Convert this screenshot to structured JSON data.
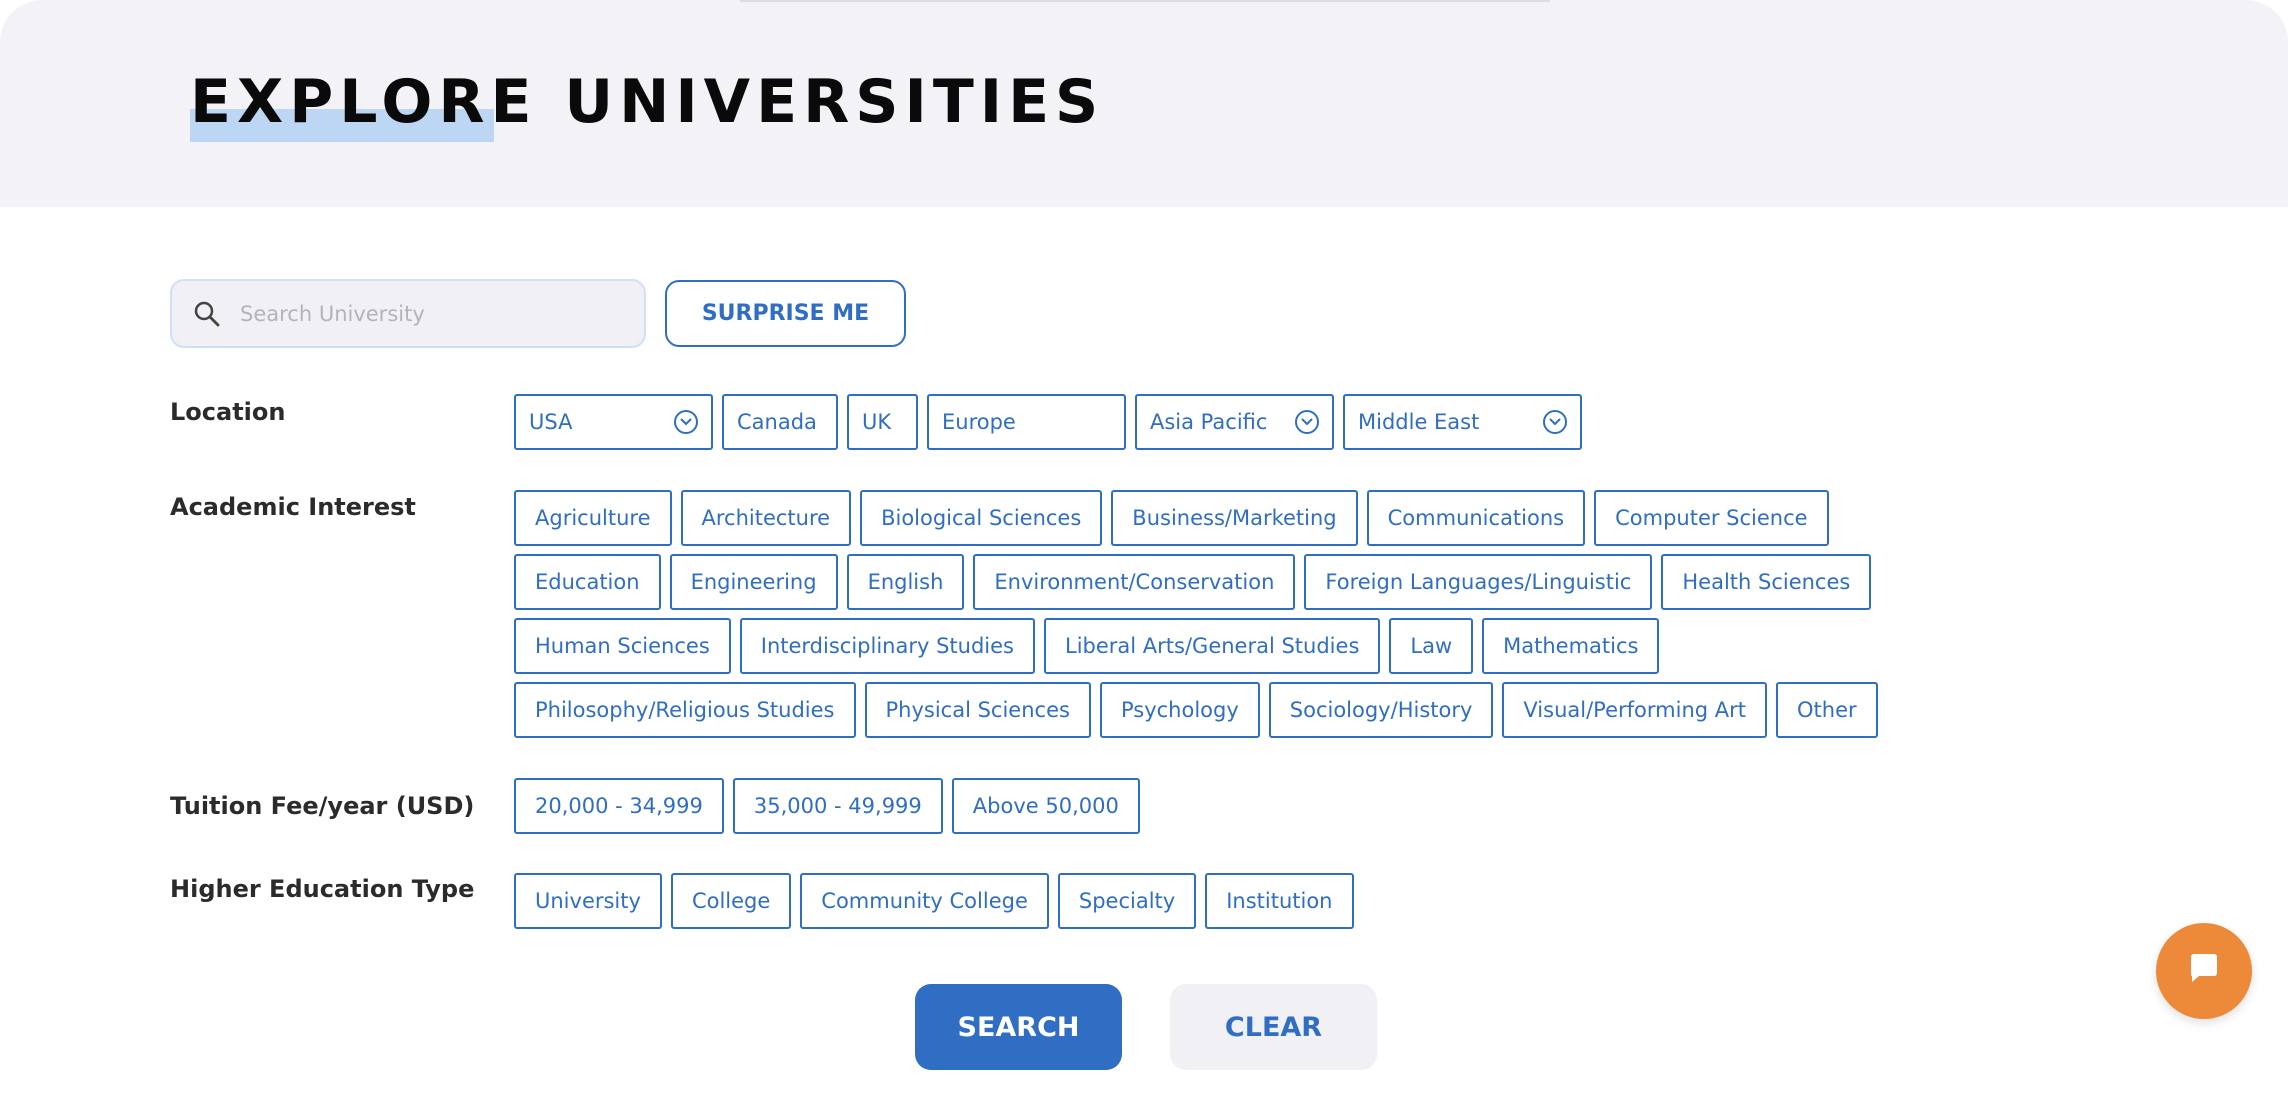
{
  "header": {
    "title": "EXPLORE UNIVERSITIES"
  },
  "search": {
    "placeholder": "Search University",
    "value": ""
  },
  "surprise_label": "SURPRISE ME",
  "filters": {
    "location": {
      "label": "Location",
      "options": [
        {
          "label": "USA",
          "dropdown": true
        },
        {
          "label": "Canada",
          "dropdown": false
        },
        {
          "label": "UK",
          "dropdown": false
        },
        {
          "label": "Europe",
          "dropdown": false
        },
        {
          "label": "Asia Pacific",
          "dropdown": true
        },
        {
          "label": "Middle East",
          "dropdown": true
        }
      ]
    },
    "academic_interest": {
      "label": "Academic Interest",
      "options": [
        "Agriculture",
        "Architecture",
        "Biological Sciences",
        "Business/Marketing",
        "Communications",
        "Computer Science",
        "Education",
        "Engineering",
        "English",
        "Environment/Conservation",
        "Foreign Languages/Linguistic",
        "Health Sciences",
        "Human Sciences",
        "Interdisciplinary Studies",
        "Liberal Arts/General Studies",
        "Law",
        "Mathematics",
        "Philosophy/Religious Studies",
        "Physical Sciences",
        "Psychology",
        "Sociology/History",
        "Visual/Performing Art",
        "Other"
      ]
    },
    "tuition": {
      "label": "Tuition Fee/year (USD)",
      "options": [
        "20,000 - 34,999",
        "35,000 - 49,999",
        "Above 50,000"
      ]
    },
    "education_type": {
      "label": "Higher Education Type",
      "options": [
        "University",
        "College",
        "Community College",
        "Specialty",
        "Institution"
      ]
    }
  },
  "actions": {
    "search_label": "SEARCH",
    "clear_label": "CLEAR"
  },
  "colors": {
    "accent": "#2f6ec3",
    "header_bg": "#f3f3f7",
    "title_highlight": "#bcd6f3",
    "chat": "#ec8a3a"
  },
  "icons": {
    "search": "search-icon",
    "dropdown": "chevron-down-icon",
    "chat": "chat-bubble-icon"
  }
}
